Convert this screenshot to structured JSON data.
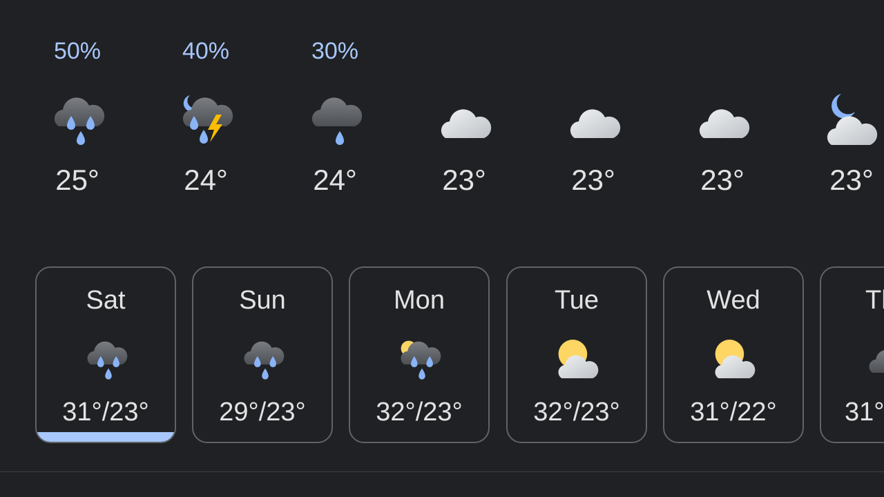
{
  "hourly": [
    {
      "precip": "50%",
      "icon": "heavy-rain-cloud-icon",
      "temp": "25°"
    },
    {
      "precip": "40%",
      "icon": "night-thunderstorm-rain-icon",
      "temp": "24°"
    },
    {
      "precip": "30%",
      "icon": "light-rain-cloud-icon",
      "temp": "24°"
    },
    {
      "precip": "",
      "icon": "cloudy-icon",
      "temp": "23°"
    },
    {
      "precip": "",
      "icon": "cloudy-icon",
      "temp": "23°"
    },
    {
      "precip": "",
      "icon": "cloudy-icon",
      "temp": "23°"
    },
    {
      "precip": "",
      "icon": "night-partly-cloudy-icon",
      "temp": "23°"
    }
  ],
  "daily": [
    {
      "day": "Sat",
      "icon": "heavy-rain-cloud-icon",
      "range": "31°/23°",
      "selected": true
    },
    {
      "day": "Sun",
      "icon": "heavy-rain-cloud-icon",
      "range": "29°/23°",
      "selected": false
    },
    {
      "day": "Mon",
      "icon": "sun-rain-cloud-icon",
      "range": "32°/23°",
      "selected": false
    },
    {
      "day": "Tue",
      "icon": "partly-sunny-icon",
      "range": "32°/23°",
      "selected": false
    },
    {
      "day": "Wed",
      "icon": "partly-sunny-icon",
      "range": "31°/22°",
      "selected": false
    },
    {
      "day": "Th",
      "icon": "cloud-icon",
      "range": "31°",
      "selected": false
    }
  ],
  "colors": {
    "background": "#202124",
    "precip_text": "#a8c7fa",
    "text": "#e3e3e3",
    "card_border": "#5f6368",
    "selected_bar": "#a8c7fa",
    "raindrop": "#8ab4f8",
    "sun": "#fdd663",
    "bolt": "#fbbc04"
  }
}
